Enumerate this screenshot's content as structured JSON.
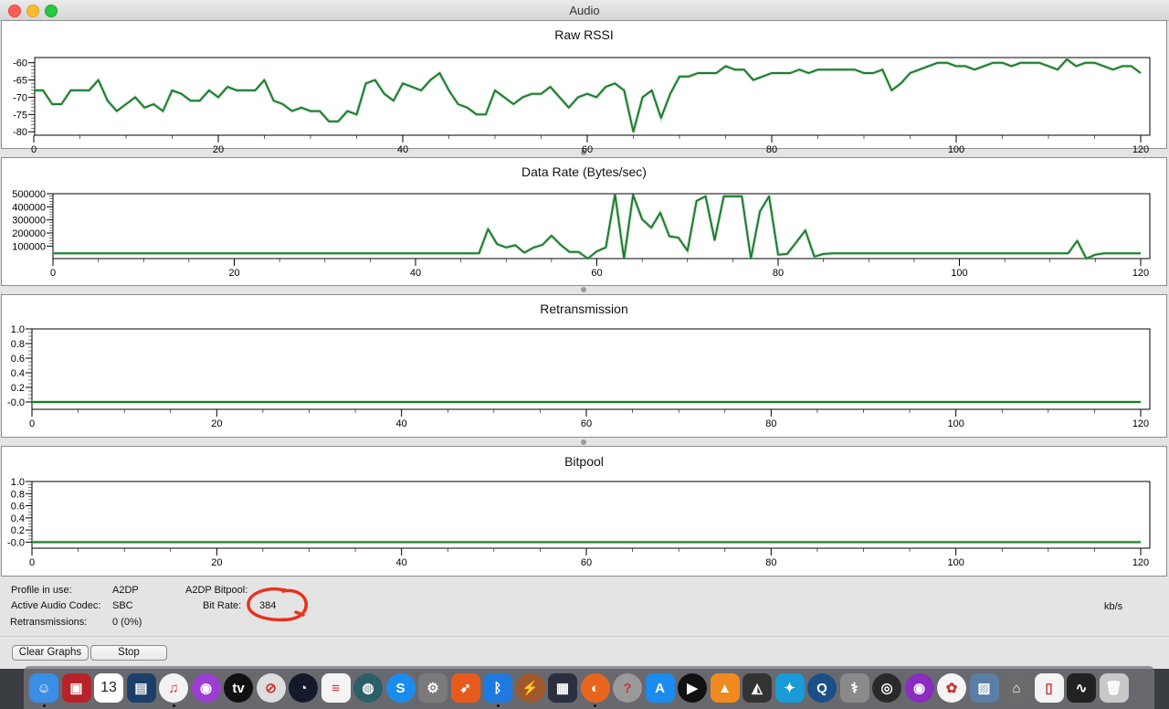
{
  "window": {
    "title": "Audio"
  },
  "colors": {
    "line": "#1f7a2f",
    "axis": "#000000",
    "annotation": "#e8321e"
  },
  "chart_data": [
    {
      "type": "line",
      "title": "Raw RSSI",
      "xlim": [
        0,
        120
      ],
      "ylim": [
        -81,
        -58.5
      ],
      "xticks": [
        0,
        20,
        40,
        60,
        80,
        100,
        120
      ],
      "yticks": [
        -60,
        -65,
        -70,
        -75,
        -80
      ],
      "x_start": 0,
      "values": [
        -68,
        -68,
        -72,
        -72,
        -68,
        -68,
        -68,
        -65,
        -71,
        -74,
        -72,
        -70,
        -73,
        -72,
        -74,
        -68,
        -69,
        -71,
        -71,
        -68,
        -70,
        -67,
        -68,
        -68,
        -68,
        -65,
        -71,
        -72,
        -74,
        -73,
        -74,
        -74,
        -77,
        -77,
        -74,
        -75,
        -66,
        -65,
        -69,
        -71,
        -66,
        -67,
        -68,
        -65,
        -63,
        -68,
        -72,
        -73,
        -75,
        -75,
        -68,
        -70,
        -72,
        -70,
        -69,
        -69,
        -67,
        -70,
        -73,
        -70,
        -69,
        -70,
        -67,
        -66,
        -68,
        -80,
        -70,
        -68,
        -76,
        -69,
        -64,
        -64,
        -63,
        -63,
        -63,
        -61,
        -62,
        -62,
        -65,
        -64,
        -63,
        -63,
        -63,
        -62,
        -63,
        -62,
        -62,
        -62,
        -62,
        -62,
        -63,
        -63,
        -62,
        -68,
        -66,
        -63,
        -62,
        -61,
        -60,
        -60,
        -61,
        -61,
        -62,
        -61,
        -60,
        -60,
        -61,
        -60,
        -60,
        -60,
        -61,
        -62,
        -59,
        -61,
        -60,
        -60,
        -61,
        -62,
        -61,
        -61,
        -63
      ]
    },
    {
      "type": "line",
      "title": "Data Rate (Bytes/sec)",
      "xlim": [
        0,
        120
      ],
      "ylim": [
        5000,
        500000
      ],
      "xticks": [
        0,
        20,
        40,
        60,
        80,
        100,
        120
      ],
      "yticks": [
        500000,
        400000,
        300000,
        200000,
        100000
      ],
      "x_start": 0,
      "values": [
        45000,
        45000,
        45000,
        45000,
        45000,
        45000,
        45000,
        45000,
        45000,
        45000,
        45000,
        45000,
        45000,
        45000,
        45000,
        45000,
        45000,
        45000,
        45000,
        45000,
        45000,
        45000,
        45000,
        45000,
        45000,
        45000,
        45000,
        45000,
        45000,
        45000,
        45000,
        45000,
        45000,
        45000,
        45000,
        45000,
        45000,
        45000,
        45000,
        45000,
        45000,
        45000,
        45000,
        45000,
        45000,
        45000,
        45000,
        45000,
        230000,
        115000,
        90000,
        107000,
        50000,
        88000,
        110000,
        180000,
        110000,
        55000,
        55000,
        5000,
        60000,
        90000,
        495000,
        5000,
        490000,
        305000,
        240000,
        355000,
        175000,
        165000,
        65000,
        445000,
        480000,
        145000,
        480000,
        480000,
        480000,
        5000,
        365000,
        480000,
        35000,
        40000,
        130000,
        220000,
        20000,
        40000,
        45000,
        45000,
        45000,
        45000,
        45000,
        45000,
        45000,
        45000,
        45000,
        45000,
        45000,
        45000,
        45000,
        45000,
        45000,
        45000,
        45000,
        45000,
        45000,
        45000,
        45000,
        45000,
        45000,
        45000,
        45000,
        45000,
        45000,
        140000,
        5000,
        35000,
        45000,
        45000,
        45000,
        45000,
        45000
      ]
    },
    {
      "type": "line",
      "title": "Retransmission",
      "xlim": [
        0,
        120
      ],
      "ylim": [
        -0.1,
        1.0
      ],
      "xticks": [
        0,
        20,
        40,
        60,
        80,
        100,
        120
      ],
      "yticks": [
        1.0,
        0.8,
        0.6,
        0.4,
        0.2,
        -0.0
      ],
      "x_start": 0,
      "values": [
        0,
        0
      ],
      "x_values": [
        0,
        120
      ]
    },
    {
      "type": "line",
      "title": "Bitpool",
      "xlim": [
        0,
        120
      ],
      "ylim": [
        -0.1,
        1.0
      ],
      "xticks": [
        0,
        20,
        40,
        60,
        80,
        100,
        120
      ],
      "yticks": [
        1.0,
        0.8,
        0.6,
        0.4,
        0.2,
        -0.0
      ],
      "x_start": 0,
      "values": [
        0,
        0
      ],
      "x_values": [
        0,
        120
      ]
    }
  ],
  "info": {
    "profile_label": "Profile in use:",
    "profile_value": "A2DP",
    "codec_label": "Active Audio Codec:",
    "codec_value": "SBC",
    "retrans_label": "Retransmissions:",
    "retrans_value": "0 (0%)",
    "bitpool_label": "A2DP Bitpool:",
    "bitrate_label": "Bit Rate:",
    "bitrate_value": "384",
    "bitrate_unit": "kb/s"
  },
  "buttons": {
    "clear": "Clear Graphs",
    "stop": "Stop"
  },
  "dock": {
    "calendar_day": "13",
    "items": [
      {
        "name": "finder",
        "color": "#3a8ee6",
        "glyph": "☺"
      },
      {
        "name": "photo-booth",
        "color": "#b8232a",
        "glyph": "▣"
      },
      {
        "name": "calendar",
        "color": "#ffffff",
        "glyph": ""
      },
      {
        "name": "image-capture",
        "color": "#1b3f6b",
        "glyph": "▤"
      },
      {
        "name": "music",
        "color": "#f2f2f2",
        "glyph": "♫"
      },
      {
        "name": "podcasts",
        "color": "#9a3fd0",
        "glyph": "◉"
      },
      {
        "name": "apple-tv",
        "color": "#111111",
        "glyph": "tv"
      },
      {
        "name": "blocked-app",
        "color": "#dddddd",
        "glyph": "⊘"
      },
      {
        "name": "speedtest",
        "color": "#141a2a",
        "glyph": "◔"
      },
      {
        "name": "textedit",
        "color": "#f4f4f4",
        "glyph": "≡"
      },
      {
        "name": "istat",
        "color": "#2a5f6a",
        "glyph": "◍"
      },
      {
        "name": "shazam",
        "color": "#1a8cf0",
        "glyph": "S"
      },
      {
        "name": "system-preferences",
        "color": "#7a7a7a",
        "glyph": "⚙"
      },
      {
        "name": "rocket",
        "color": "#e65a1e",
        "glyph": "➶"
      },
      {
        "name": "bluetooth",
        "color": "#1f7ae0",
        "glyph": "ᛒ"
      },
      {
        "name": "reeder",
        "color": "#a0582a",
        "glyph": "⚡"
      },
      {
        "name": "mixer",
        "color": "#2b3040",
        "glyph": "▦"
      },
      {
        "name": "firefox",
        "color": "#e8651e",
        "glyph": "◐"
      },
      {
        "name": "help",
        "color": "#9a9a9a",
        "glyph": "?"
      },
      {
        "name": "app-store",
        "color": "#1a8cf0",
        "glyph": "A"
      },
      {
        "name": "infuse",
        "color": "#111111",
        "glyph": "▶"
      },
      {
        "name": "vlc",
        "color": "#f08a1e",
        "glyph": "▲"
      },
      {
        "name": "monodraw",
        "color": "#333333",
        "glyph": "◭"
      },
      {
        "name": "kodi",
        "color": "#1a9ad6",
        "glyph": "✦"
      },
      {
        "name": "quicktime",
        "color": "#1c4f88",
        "glyph": "Q"
      },
      {
        "name": "disk-utility",
        "color": "#8a8a8a",
        "glyph": "⚕"
      },
      {
        "name": "speaker-app",
        "color": "#2a2a2a",
        "glyph": "◎"
      },
      {
        "name": "radio-app",
        "color": "#8a2cc0",
        "glyph": "◉"
      },
      {
        "name": "photos",
        "color": "#f4f4f4",
        "glyph": "✿"
      },
      {
        "name": "preview",
        "color": "#5a7ea6",
        "glyph": "▨"
      },
      {
        "name": "airport-utility",
        "color": "#6a6a6a",
        "glyph": "⌂"
      },
      {
        "name": "document",
        "color": "#f4f4f4",
        "glyph": "▯"
      },
      {
        "name": "activity-monitor",
        "color": "#222222",
        "glyph": "∿"
      },
      {
        "name": "trash",
        "color": "#c8c8c8",
        "glyph": "🗑"
      }
    ]
  }
}
